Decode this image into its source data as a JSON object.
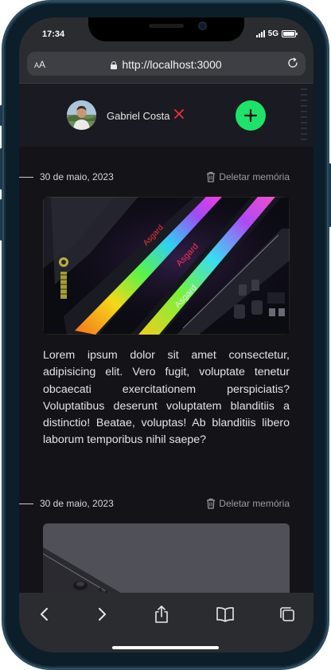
{
  "status_bar": {
    "time": "17:34",
    "network": "5G"
  },
  "browser": {
    "text_size_small": "A",
    "text_size_large": "A",
    "url": "http://localhost:3000"
  },
  "header": {
    "user_name": "Gabriel Costa",
    "logout_icon": "close-icon",
    "add_icon": "plus-icon",
    "accent_color": "#1ee26a",
    "logout_color": "#e8323c"
  },
  "memories": [
    {
      "date": "30 de maio, 2023",
      "delete_label": "Deletar memória",
      "image_brand": "Asgard",
      "text": "Lorem ipsum dolor sit amet consectetur, adipisicing elit. Vero fugit, voluptate tenetur obcaecati exercitationem perspiciatis? Voluptatibus deserunt voluptatem blanditiis a distinctio! Beatae, voluptas! Ab blanditiis libero laborum temporibus nihil saepe?"
    },
    {
      "date": "30 de maio, 2023",
      "delete_label": "Deletar memória"
    }
  ],
  "toolbar": {
    "icons": [
      "back-icon",
      "forward-icon",
      "share-icon",
      "bookmarks-icon",
      "tabs-icon"
    ]
  }
}
